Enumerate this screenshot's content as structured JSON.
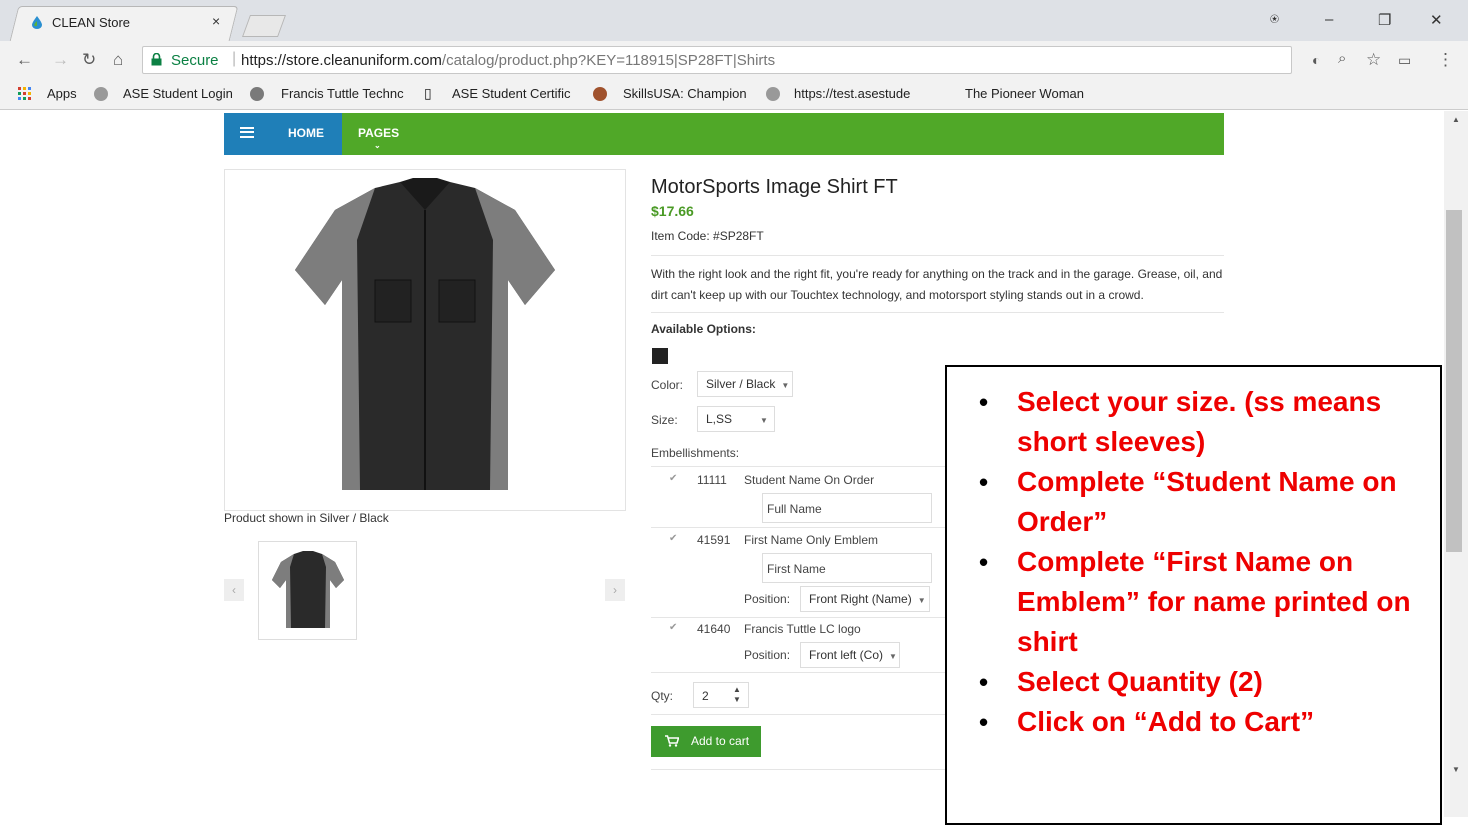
{
  "browser": {
    "tab_title": "CLEAN Store",
    "tab_close": "×",
    "secure_label": "Secure",
    "url_host": "https://store.cleanuniform.com",
    "url_path": "/catalog/product.php?KEY=118915|SP28FT|Shirts",
    "window_controls": {
      "account": "⍟",
      "minimize": "–",
      "maximize": "❐",
      "close": "✕"
    }
  },
  "bookmarks": [
    {
      "label": "Apps"
    },
    {
      "label": "ASE Student Login"
    },
    {
      "label": "Francis Tuttle Technc"
    },
    {
      "label": "ASE Student Certific"
    },
    {
      "label": "SkillsUSA: Champion"
    },
    {
      "label": "https://test.asestude"
    },
    {
      "label": "The Pioneer Woman"
    }
  ],
  "site_nav": {
    "home": "HOME",
    "pages": "PAGES"
  },
  "product": {
    "name": "MotorSports Image Shirt FT",
    "price": "$17.66",
    "item_code": "Item Code: #SP28FT",
    "description": "With the right look and the right fit, you're ready for anything on the track and in the garage. Grease, oil, and dirt can't keep up with our Touchtex technology, and motorsport styling stands out in a crowd.",
    "caption": "Product shown in Silver / Black",
    "available_options": "Available Options:",
    "color_label": "Color:",
    "color_value": "Silver / Black",
    "size_label": "Size:",
    "size_value": "L,SS",
    "embellishments_label": "Embellishments:",
    "emb1_code": "11111",
    "emb1_name": "Student Name On Order",
    "emb1_placeholder": "Full Name",
    "emb2_code": "41591",
    "emb2_name": "First Name Only Emblem",
    "emb2_placeholder": "First Name",
    "emb2_position_label": "Position:",
    "emb2_position_value": "Front Right (Name)",
    "emb3_code": "41640",
    "emb3_name": "Francis Tuttle LC logo",
    "emb3_position_label": "Position:",
    "emb3_position_value": "Front left (Co)",
    "qty_label": "Qty:",
    "qty_value": "2",
    "add_to_cart": "Add to cart"
  },
  "instructions": [
    "Select your size. (ss means short sleeves)",
    "Complete “Student Name on Order”",
    "Complete “First Name on Emblem” for name printed on shirt",
    "Select Quantity (2)",
    "Click on “Add to Cart”"
  ],
  "colors": {
    "nav_green": "#50a828",
    "nav_blue": "#1f7fb8",
    "price_green": "#4a9a25",
    "note_red": "#e00000"
  }
}
